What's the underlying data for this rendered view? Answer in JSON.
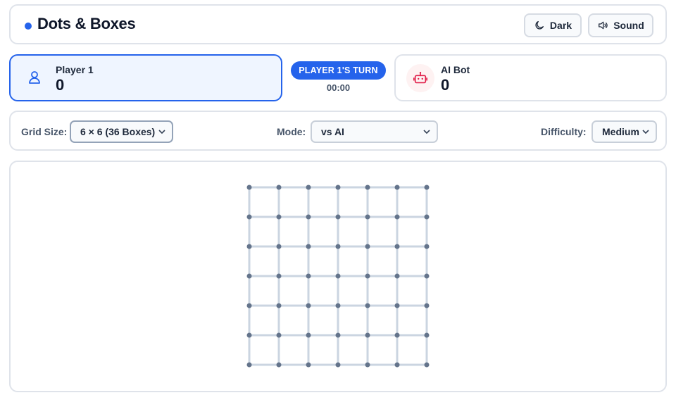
{
  "header": {
    "title": "Dots & Boxes",
    "dark_label": "Dark",
    "sound_label": "Sound"
  },
  "players": {
    "p1": {
      "name": "Player 1",
      "score": "0"
    },
    "p2": {
      "name": "AI Bot",
      "score": "0"
    }
  },
  "turn": {
    "label": "PLAYER 1'S TURN",
    "timer": "00:00"
  },
  "controls": {
    "grid_label": "Grid Size:",
    "grid_value": "6 × 6 (36 Boxes)",
    "mode_label": "Mode:",
    "mode_value": "vs AI",
    "difficulty_label": "Difficulty:",
    "difficulty_value": "Medium"
  },
  "board": {
    "boxes": 6,
    "drawn_lines": []
  },
  "colors": {
    "accent": "#2563eb",
    "dot": "#64748b",
    "empty_line": "#cbd5e1",
    "bot_icon": "#e11d48"
  },
  "icons": {
    "dark": "moon-icon",
    "sound": "speaker-icon",
    "player": "user-icon",
    "bot": "robot-icon"
  }
}
